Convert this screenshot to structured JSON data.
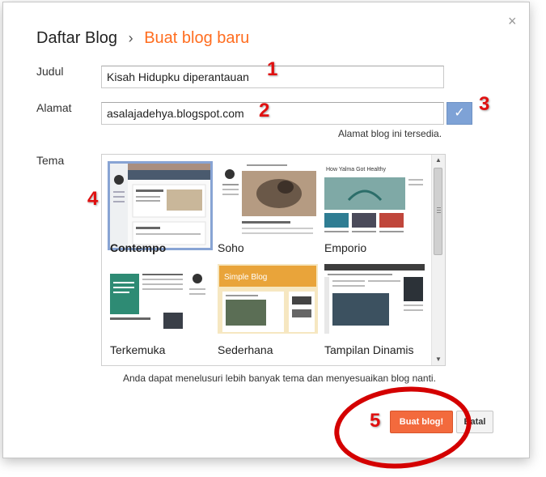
{
  "header": {
    "breadcrumb_root": "Daftar Blog",
    "separator": "›",
    "subtitle": "Buat blog baru",
    "close_glyph": "×"
  },
  "form": {
    "title_label": "Judul",
    "title_value": "Kisah Hidupku diperantauan",
    "address_label": "Alamat",
    "address_value": "asalajadehya.blogspot.com",
    "address_status": "Alamat blog ini tersedia.",
    "check_glyph": "✓",
    "theme_label": "Tema"
  },
  "themes": [
    {
      "name": "Contempo",
      "selected": true
    },
    {
      "name": "Soho",
      "selected": false
    },
    {
      "name": "Emporio",
      "selected": false
    },
    {
      "name": "Terkemuka",
      "selected": false
    },
    {
      "name": "Sederhana",
      "selected": false
    },
    {
      "name": "Tampilan Dinamis",
      "selected": false
    }
  ],
  "thumb_text": {
    "emporio_heading": "How Yalma Got Healthy",
    "simple_heading": "Simple Blog"
  },
  "note": "Anda dapat menelusuri lebih banyak tema dan menyesuaikan blog nanti.",
  "buttons": {
    "create": "Buat blog!",
    "cancel": "Batal"
  },
  "annotations": [
    "1",
    "2",
    "3",
    "4",
    "5"
  ],
  "colors": {
    "accent": "#ff6d1f",
    "create_button": "#f36a3d",
    "check_button": "#7ea2d6",
    "annotation": "#e01010"
  },
  "icons": {
    "close": "close-icon",
    "check": "check-icon",
    "scroll_up": "scroll-up-icon",
    "scroll_down": "scroll-down-icon"
  }
}
